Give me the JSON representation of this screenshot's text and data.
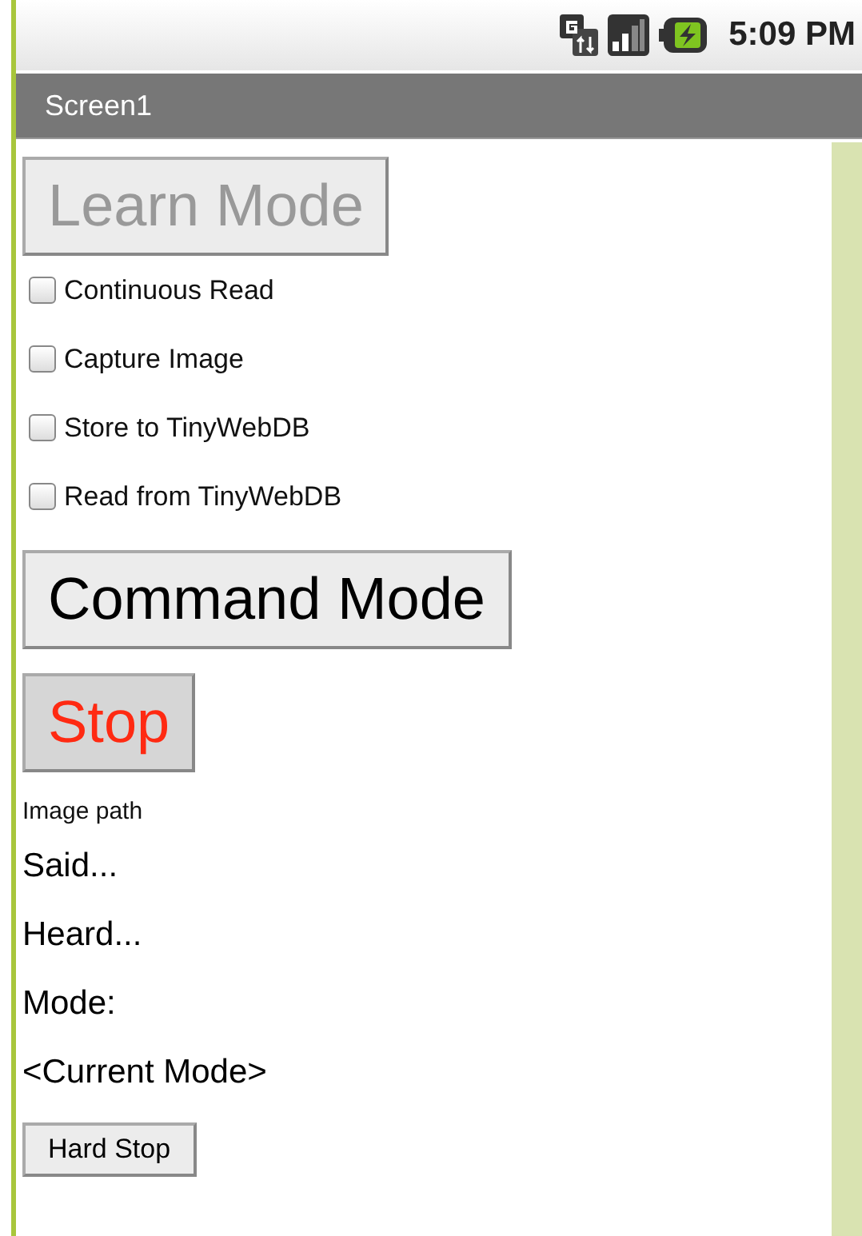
{
  "status_bar": {
    "time": "5:09 PM"
  },
  "title_bar": {
    "title": "Screen1"
  },
  "components": [
    {
      "kind": "bigbutton",
      "label": "Learn Mode",
      "disabled": true
    },
    {
      "kind": "checkbox",
      "label": "Continuous Read",
      "checked": false
    },
    {
      "kind": "checkbox",
      "label": "Capture Image",
      "checked": false
    },
    {
      "kind": "checkbox",
      "label": "Store to TinyWebDB",
      "checked": false
    },
    {
      "kind": "checkbox",
      "label": "Read from TinyWebDB",
      "checked": false
    },
    {
      "kind": "bigbutton",
      "label": "Command Mode",
      "disabled": false
    },
    {
      "kind": "bigbutton",
      "label": "Stop",
      "disabled": false,
      "color": "#ff2a12"
    },
    {
      "kind": "caption",
      "text": "Image path"
    },
    {
      "kind": "label",
      "text": "Said..."
    },
    {
      "kind": "label",
      "text": "Heard..."
    },
    {
      "kind": "label",
      "text": "Mode:"
    },
    {
      "kind": "label",
      "text": "<Current Mode>"
    },
    {
      "kind": "button",
      "label": "Hard Stop"
    }
  ]
}
